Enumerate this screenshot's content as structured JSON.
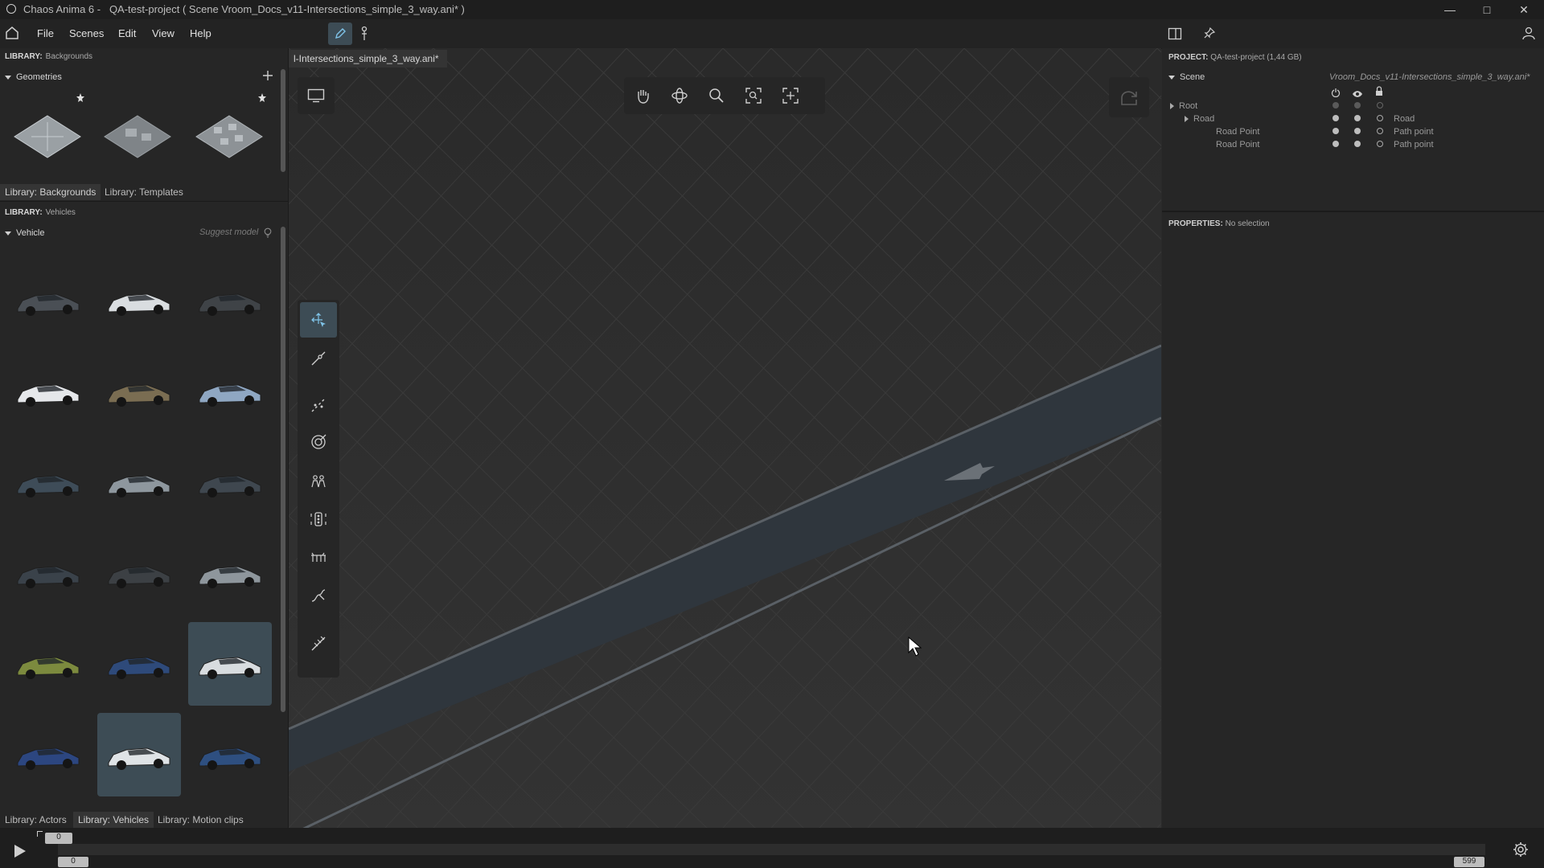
{
  "window": {
    "title": "Chaos Anima 6 -   QA-test-project ( Scene Vroom_Docs_v11-Intersections_simple_3_way.ani* )",
    "minimize_icon": "minimize-icon",
    "maximize_icon": "maximize-icon",
    "close_icon": "close-icon"
  },
  "menu": {
    "items": [
      "File",
      "Scenes",
      "Edit",
      "View",
      "Help"
    ]
  },
  "left_panel": {
    "library_top": {
      "label": "LIBRARY:",
      "value": "Backgrounds"
    },
    "geometries_section": "Geometries",
    "top_tabs": [
      "Library: Backgrounds",
      "Library: Templates"
    ],
    "library_vehicles": {
      "label": "LIBRARY:",
      "value": "Vehicles"
    },
    "vehicle_section": "Vehicle",
    "suggest_model": "Suggest model",
    "bottom_tabs": [
      "Library: Actors",
      "Library: Vehicles",
      "Library: Motion clips"
    ]
  },
  "viewport": {
    "tab_label": "l-Intersections_simple_3_way.ani*"
  },
  "right_panel": {
    "project_label": "PROJECT:",
    "project_value": "QA-test-project (1,44 GB)",
    "scene_label": "Scene",
    "scene_file": "Vroom_Docs_v11-Intersections_simple_3_way.ani*",
    "tree": [
      {
        "name": "Root",
        "type": ""
      },
      {
        "name": "Road",
        "type": "Road"
      },
      {
        "name": "Road Point",
        "type": "Path point"
      },
      {
        "name": "Road Point",
        "type": "Path point"
      }
    ],
    "properties_label": "PROPERTIES:",
    "properties_value": "No selection"
  },
  "timeline": {
    "current_frame": "0",
    "start_frame": "0",
    "end_frame": "599"
  },
  "colors": {
    "accent_selected": "#3d4c55",
    "road": "#2f363d"
  }
}
